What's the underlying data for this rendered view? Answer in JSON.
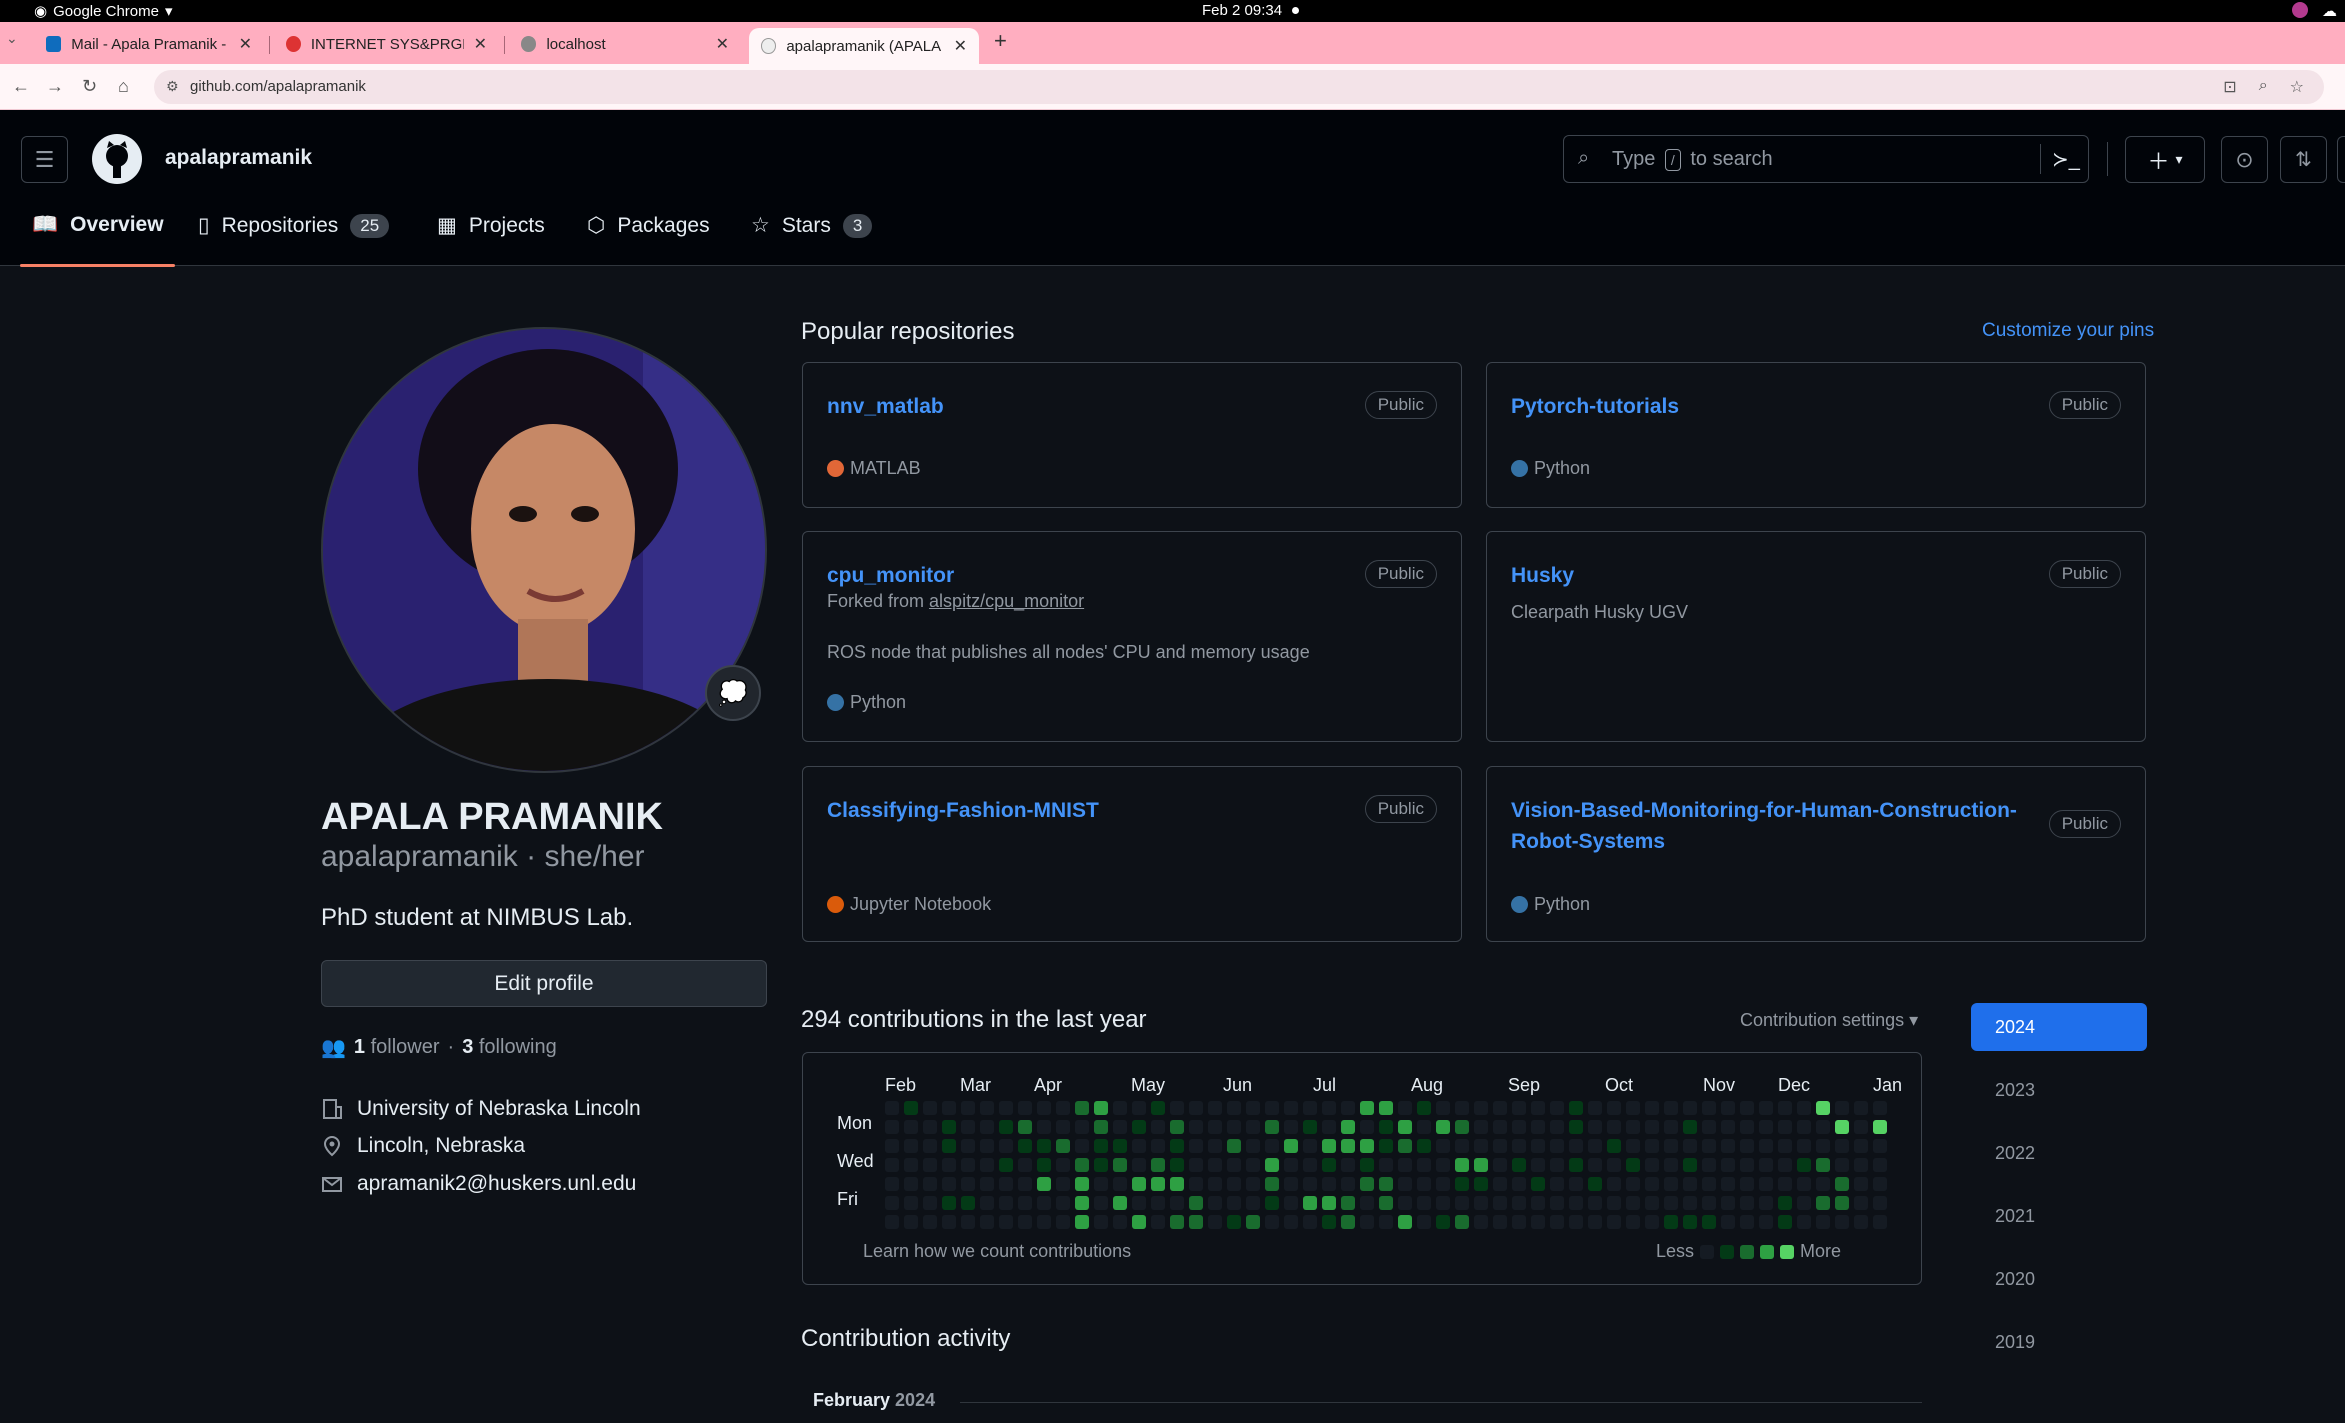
{
  "os": {
    "app_name": "Google Chrome",
    "clock": "Feb 2  09:34"
  },
  "browser": {
    "tabs": [
      {
        "label": "Mail - Apala Pramanik - O",
        "favicon_color": "#0f6cbd"
      },
      {
        "label": "INTERNET SYS&PRGMMI",
        "favicon_color": "#d33"
      },
      {
        "label": "localhost",
        "favicon_color": "#888"
      },
      {
        "label": "apalapramanik (APALA P",
        "favicon_color": "#eee"
      }
    ],
    "url": "github.com/apalapramanik"
  },
  "header": {
    "username": "apalapramanik",
    "search_prefix": "Type",
    "search_key": "/",
    "search_suffix": "to search"
  },
  "nav": {
    "overview": "Overview",
    "repositories": "Repositories",
    "repositories_count": "25",
    "projects": "Projects",
    "packages": "Packages",
    "stars": "Stars",
    "stars_count": "3"
  },
  "profile": {
    "full_name": "APALA PRAMANIK",
    "login_line": "apalapramanik · she/her",
    "bio": "PhD student at NIMBUS Lab.",
    "edit_button": "Edit profile",
    "followers_count": "1",
    "followers_label": "follower",
    "separator": "·",
    "following_count": "3",
    "following_label": "following",
    "organization": "University of Nebraska Lincoln",
    "location": "Lincoln, Nebraska",
    "email": "apramanik2@huskers.unl.edu"
  },
  "popular": {
    "title": "Popular repositories",
    "customize": "Customize your pins",
    "repos": [
      {
        "name": "nnv_matlab",
        "badge": "Public",
        "language": "MATLAB",
        "lang_color": "#e16737"
      },
      {
        "name": "Pytorch-tutorials",
        "badge": "Public",
        "language": "Python",
        "lang_color": "#3572A5"
      },
      {
        "name": "cpu_monitor",
        "badge": "Public",
        "fork_prefix": "Forked from",
        "fork_source": "alspitz/cpu_monitor",
        "description": "ROS node that publishes all nodes' CPU and memory usage",
        "language": "Python",
        "lang_color": "#3572A5"
      },
      {
        "name": "Husky",
        "badge": "Public",
        "description": "Clearpath Husky UGV"
      },
      {
        "name": "Classifying-Fashion-MNIST",
        "badge": "Public",
        "language": "Jupyter Notebook",
        "lang_color": "#DA5B0B"
      },
      {
        "name": "Vision-Based-Monitoring-for-Human-Construction-Robot-Systems",
        "badge": "Public",
        "language": "Python",
        "lang_color": "#3572A5"
      }
    ]
  },
  "contributions": {
    "title": "294 contributions in the last year",
    "settings": "Contribution settings",
    "months": [
      "Feb",
      "Mar",
      "Apr",
      "May",
      "Jun",
      "Jul",
      "Aug",
      "Sep",
      "Oct",
      "Nov",
      "Dec",
      "Jan"
    ],
    "days": [
      "Mon",
      "Wed",
      "Fri"
    ],
    "learn": "Learn how we count contributions",
    "less": "Less",
    "more": "More",
    "colors": [
      "#151b23",
      "#033a16",
      "#196c2e",
      "#2ea043",
      "#56d364"
    ]
  },
  "years": [
    "2024",
    "2023",
    "2022",
    "2021",
    "2020",
    "2019"
  ],
  "activity": {
    "title": "Contribution activity",
    "month": "February",
    "year": "2024"
  }
}
